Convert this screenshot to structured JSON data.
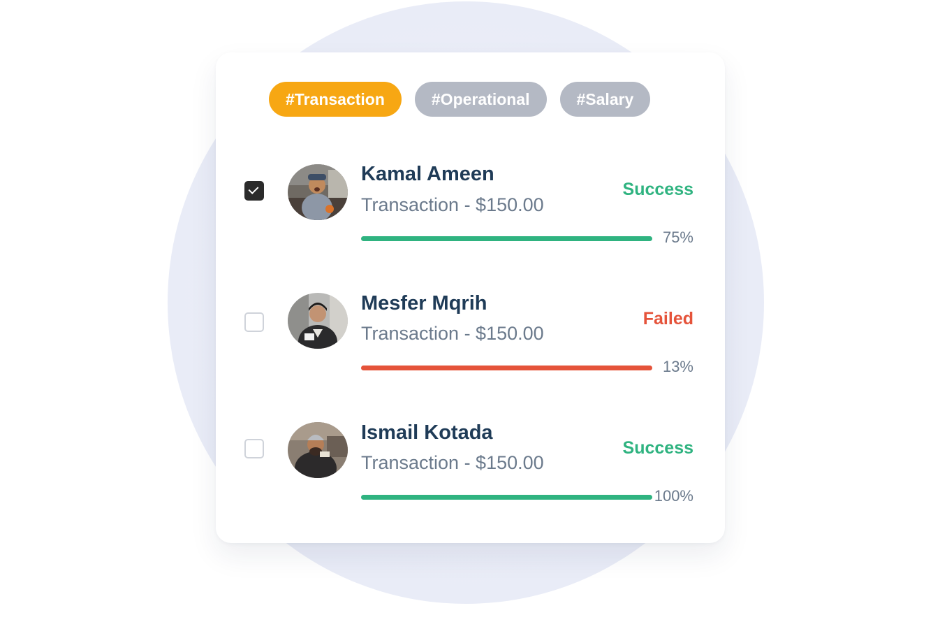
{
  "tags": [
    {
      "label": "#Transaction",
      "active": true
    },
    {
      "label": "#Operational",
      "active": false
    },
    {
      "label": "#Salary",
      "active": false
    }
  ],
  "colors": {
    "accent": "#f7a713",
    "success": "#2fb380",
    "failed": "#e5533a",
    "tag_inactive": "#b4b9c4",
    "name": "#1f3b57",
    "muted": "#6b7a8c"
  },
  "transactions": [
    {
      "checked": true,
      "avatar": "avatar-photo-kamal",
      "name": "Kamal Ameen",
      "description": "Transaction - $150.00",
      "status": "Success",
      "status_type": "success",
      "progress": 0.75,
      "progress_label": "75%"
    },
    {
      "checked": false,
      "avatar": "avatar-photo-mesfer",
      "name": "Mesfer Mqrih",
      "description": "Transaction - $150.00",
      "status": "Failed",
      "status_type": "failed",
      "progress": 0.13,
      "progress_label": "13%"
    },
    {
      "checked": false,
      "avatar": "avatar-photo-ismail",
      "name": "Ismail Kotada",
      "description": "Transaction - $150.00",
      "status": "Success",
      "status_type": "success",
      "progress": 1.0,
      "progress_label": "100%"
    }
  ]
}
